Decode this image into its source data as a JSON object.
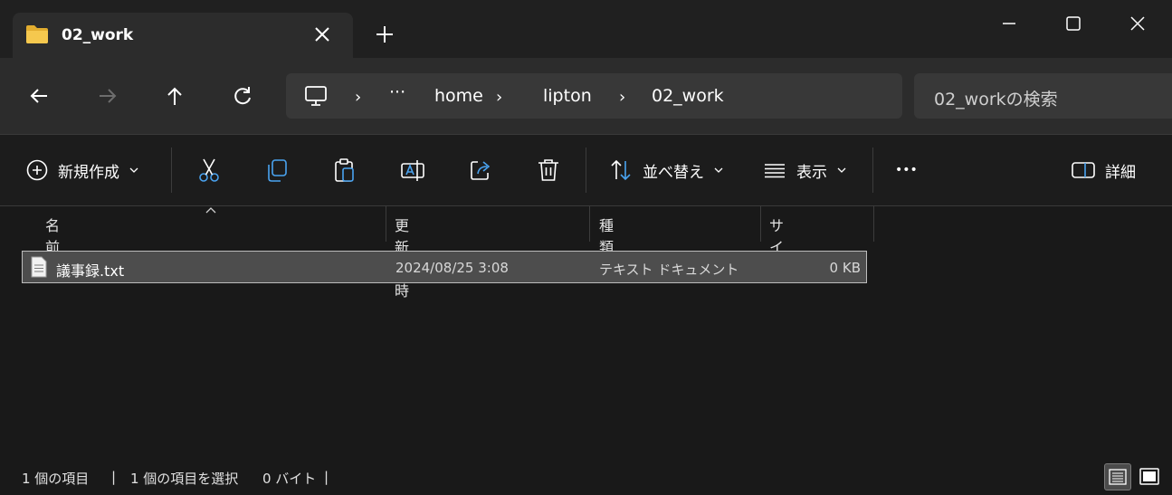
{
  "tab": {
    "title": "02_work"
  },
  "address": {
    "crumbs": [
      "home",
      "lipton",
      "02_work"
    ],
    "overflow": "···"
  },
  "search": {
    "placeholder": "02_workの検索"
  },
  "commands": {
    "new": "新規作成",
    "sort": "並べ替え",
    "view": "表示",
    "more": "•••",
    "details": "詳細"
  },
  "columns": {
    "name": "名前",
    "modified": "更新日時",
    "type": "種類",
    "size": "サイズ"
  },
  "files": [
    {
      "name": "議事録.txt",
      "modified": "2024/08/25 3:08",
      "type": "テキスト ドキュメント",
      "size": "0 KB"
    }
  ],
  "status": {
    "count": "1 個の項目",
    "divider": "|",
    "selected": "1 個の項目を選択",
    "selected_size": "0 バイト"
  },
  "colors": {
    "folder": "#f0c24b",
    "accent": "#4aa3f0",
    "background": "#191919"
  }
}
